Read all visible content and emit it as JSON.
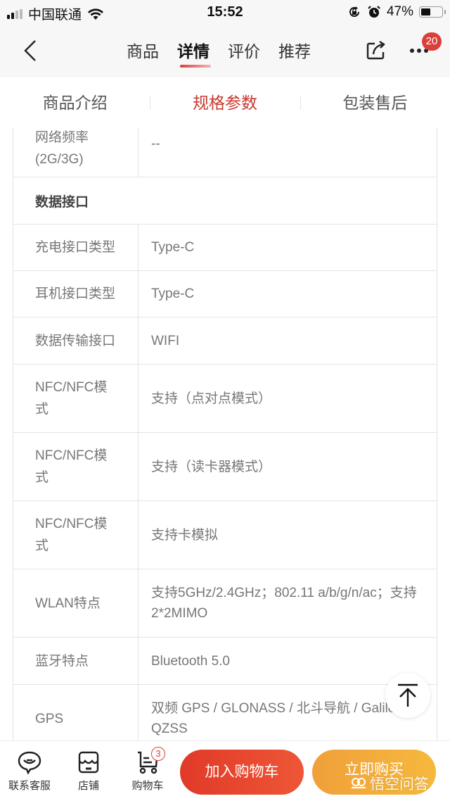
{
  "status_bar": {
    "carrier": "中国联通",
    "time": "15:52",
    "battery_percent": "47%",
    "battery_level": 0.47,
    "signal_bars": 2,
    "icons": [
      "signal-icon",
      "wifi-icon",
      "rotation-lock-icon",
      "alarm-icon",
      "battery-icon"
    ]
  },
  "nav": {
    "tabs": [
      {
        "label": "商品",
        "active": false
      },
      {
        "label": "详情",
        "active": true
      },
      {
        "label": "评价",
        "active": false
      },
      {
        "label": "推荐",
        "active": false
      }
    ],
    "more_badge": "20",
    "accent": "#d9403a"
  },
  "sub_tabs": [
    {
      "label": "商品介绍",
      "active": false
    },
    {
      "label": "规格参数",
      "active": true
    },
    {
      "label": "包装售后",
      "active": false
    }
  ],
  "spec": {
    "rows": [
      {
        "type": "row",
        "key": "网络频率\n(2G/3G)",
        "value": "--"
      },
      {
        "type": "section",
        "title": "数据接口"
      },
      {
        "type": "row",
        "key": "充电接口类型",
        "value": "Type-C"
      },
      {
        "type": "row",
        "key": "耳机接口类型",
        "value": "Type-C"
      },
      {
        "type": "row",
        "key": "数据传输接口",
        "value": "WIFI"
      },
      {
        "type": "row",
        "key": "NFC/NFC模式",
        "value": "支持（点对点模式）"
      },
      {
        "type": "row",
        "key": "NFC/NFC模式",
        "value": "支持（读卡器模式）"
      },
      {
        "type": "row",
        "key": "NFC/NFC模式",
        "value": "支持卡模拟"
      },
      {
        "type": "row",
        "key": "WLAN特点",
        "value": "支持5GHz/2.4GHz；802.11 a/b/g/n/ac；支持2*2MIMO"
      },
      {
        "type": "row",
        "key": "蓝牙特点",
        "value": "Bluetooth 5.0"
      },
      {
        "type": "row",
        "key": "GPS",
        "value": "双频 GPS / GLONASS / 北斗导航 / Galileo / QZSS"
      }
    ]
  },
  "bottom_bar": {
    "service_label": "联系客服",
    "store_label": "店铺",
    "cart_label": "购物车",
    "cart_count": "3",
    "add_to_cart_label": "加入购物车",
    "buy_now_label": "立即购买",
    "add_to_cart_color": "#e4422d",
    "buy_now_color": "#f3ad3a"
  },
  "watermark": {
    "text": "悟空问答"
  }
}
